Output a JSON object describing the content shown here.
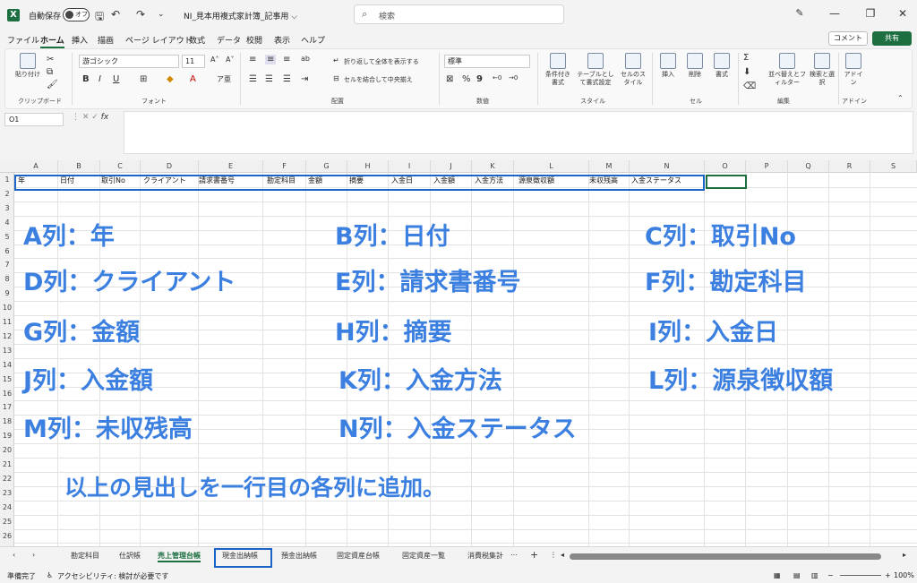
{
  "titlebar": {
    "app_icon": "excel-logo",
    "autosave_label": "自動保存",
    "autosave_state": "オフ",
    "doc_title": "NI_見本用複式家計簿_記事用 ⌵",
    "search_placeholder": "検索"
  },
  "menu_tabs": [
    "ファイル",
    "ホーム",
    "挿入",
    "描画",
    "ページ レイアウト",
    "数式",
    "データ",
    "校閲",
    "表示",
    "ヘルプ"
  ],
  "active_tab": "ホーム",
  "comment_label": "コメント",
  "share_label": "共有",
  "ribbon": {
    "clipboard": {
      "paste_label": "貼り付け",
      "group_label": "クリップボード"
    },
    "font": {
      "family": "游ゴシック",
      "size": "11",
      "group_label": "フォント"
    },
    "alignment": {
      "wrap_label": "折り返して全体を表示する",
      "merge_label": "セルを結合して中央揃え",
      "group_label": "配置"
    },
    "number": {
      "format": "標準",
      "group_label": "数値"
    },
    "styles": {
      "cond_label": "条件付き書式",
      "table_label": "テーブルとして書式設定",
      "cell_style_label": "セルのスタイル",
      "group_label": "スタイル"
    },
    "cells": {
      "insert_label": "挿入",
      "delete_label": "削除",
      "format_label": "書式",
      "group_label": "セル"
    },
    "editing": {
      "sort_label": "並べ替えとフィルター",
      "find_label": "検索と選択",
      "group_label": "編集"
    },
    "addins": {
      "label": "アドイン",
      "group_label": "アドイン"
    }
  },
  "namebox": "O1",
  "fx": "fx",
  "columns": [
    "A",
    "B",
    "C",
    "D",
    "E",
    "F",
    "G",
    "H",
    "I",
    "J",
    "K",
    "L",
    "M",
    "N",
    "O",
    "P",
    "Q",
    "R",
    "S"
  ],
  "rows": [
    "1",
    "2",
    "3",
    "4",
    "5",
    "6",
    "7",
    "8",
    "9",
    "10",
    "11",
    "12",
    "13",
    "14",
    "15",
    "16",
    "17",
    "18",
    "19",
    "20",
    "21",
    "22",
    "23",
    "24",
    "25",
    "26"
  ],
  "row1_cells": [
    "年",
    "日付",
    "取引No",
    "クライアント",
    "請求書番号",
    "勘定科目",
    "金額",
    "摘要",
    "入金日",
    "入金額",
    "入金方法",
    "源泉徴収額",
    "未収残高",
    "入金ステータス"
  ],
  "annotations": [
    "A列：年",
    "B列：日付",
    "C列：取引No",
    "D列：クライアント",
    "E列：請求書番号",
    "F列：勘定科目",
    "G列：金額",
    "H列：摘要",
    "I列：入金日",
    "J列：入金額",
    "K列：入金方法",
    "L列：源泉徴収額",
    "M列：未収残高",
    "N列：入金ステータス"
  ],
  "annotation_note": "以上の見出しを一行目の各列に追加。",
  "sheet_tabs": [
    "勘定科目",
    "仕訳帳",
    "売上管理台帳",
    "現金出納帳",
    "預金出納帳",
    "固定資産台帳",
    "固定資産一覧",
    "消費税集計"
  ],
  "active_sheet": "売上管理台帳",
  "status": {
    "ready": "準備完了",
    "accessibility": "アクセシビリティ: 検討が必要です",
    "zoom": "100%"
  },
  "colors": {
    "accent": "#1d6f42",
    "annotation": "#3b7fe0",
    "highlight_box": "#1a63c7"
  }
}
